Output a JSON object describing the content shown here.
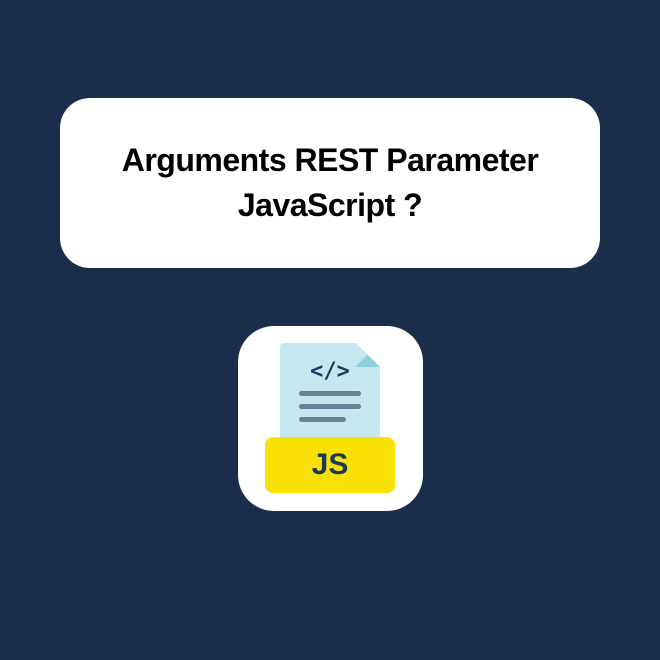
{
  "titleCard": {
    "line1": "Arguments REST Parameter",
    "line2": "JavaScript ?"
  },
  "iconCard": {
    "codeBrackets": "</>",
    "jsLabel": "JS"
  }
}
